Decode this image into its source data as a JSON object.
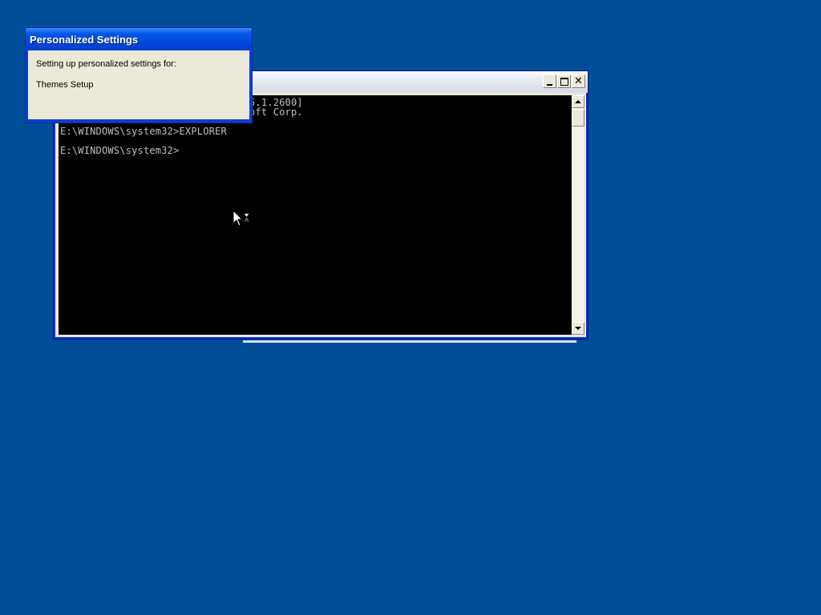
{
  "console": {
    "lines": [
      "5.1.2600]",
      "oft Corp.",
      "E:\\WINDOWS\\system32>EXPLORER",
      "E:\\WINDOWS\\system32>"
    ]
  },
  "dialog": {
    "title": "Personalized Settings",
    "message": "Setting up personalized settings for:",
    "item": "Themes Setup"
  },
  "icons": {
    "cursor": "busy-arrow-hourglass-icon",
    "minimize": "minimize-icon",
    "maximize": "maximize-icon",
    "close": "close-icon",
    "scroll_up": "scroll-up-arrow-icon",
    "scroll_down": "scroll-down-arrow-icon"
  },
  "colors": {
    "desktop": "#004e98",
    "console_bg": "#000000",
    "console_text": "#c0c0c0",
    "title_blue": "#0058e6",
    "dialog_body": "#ece9d8"
  },
  "title_buttons": {
    "close_glyph": "✕"
  }
}
